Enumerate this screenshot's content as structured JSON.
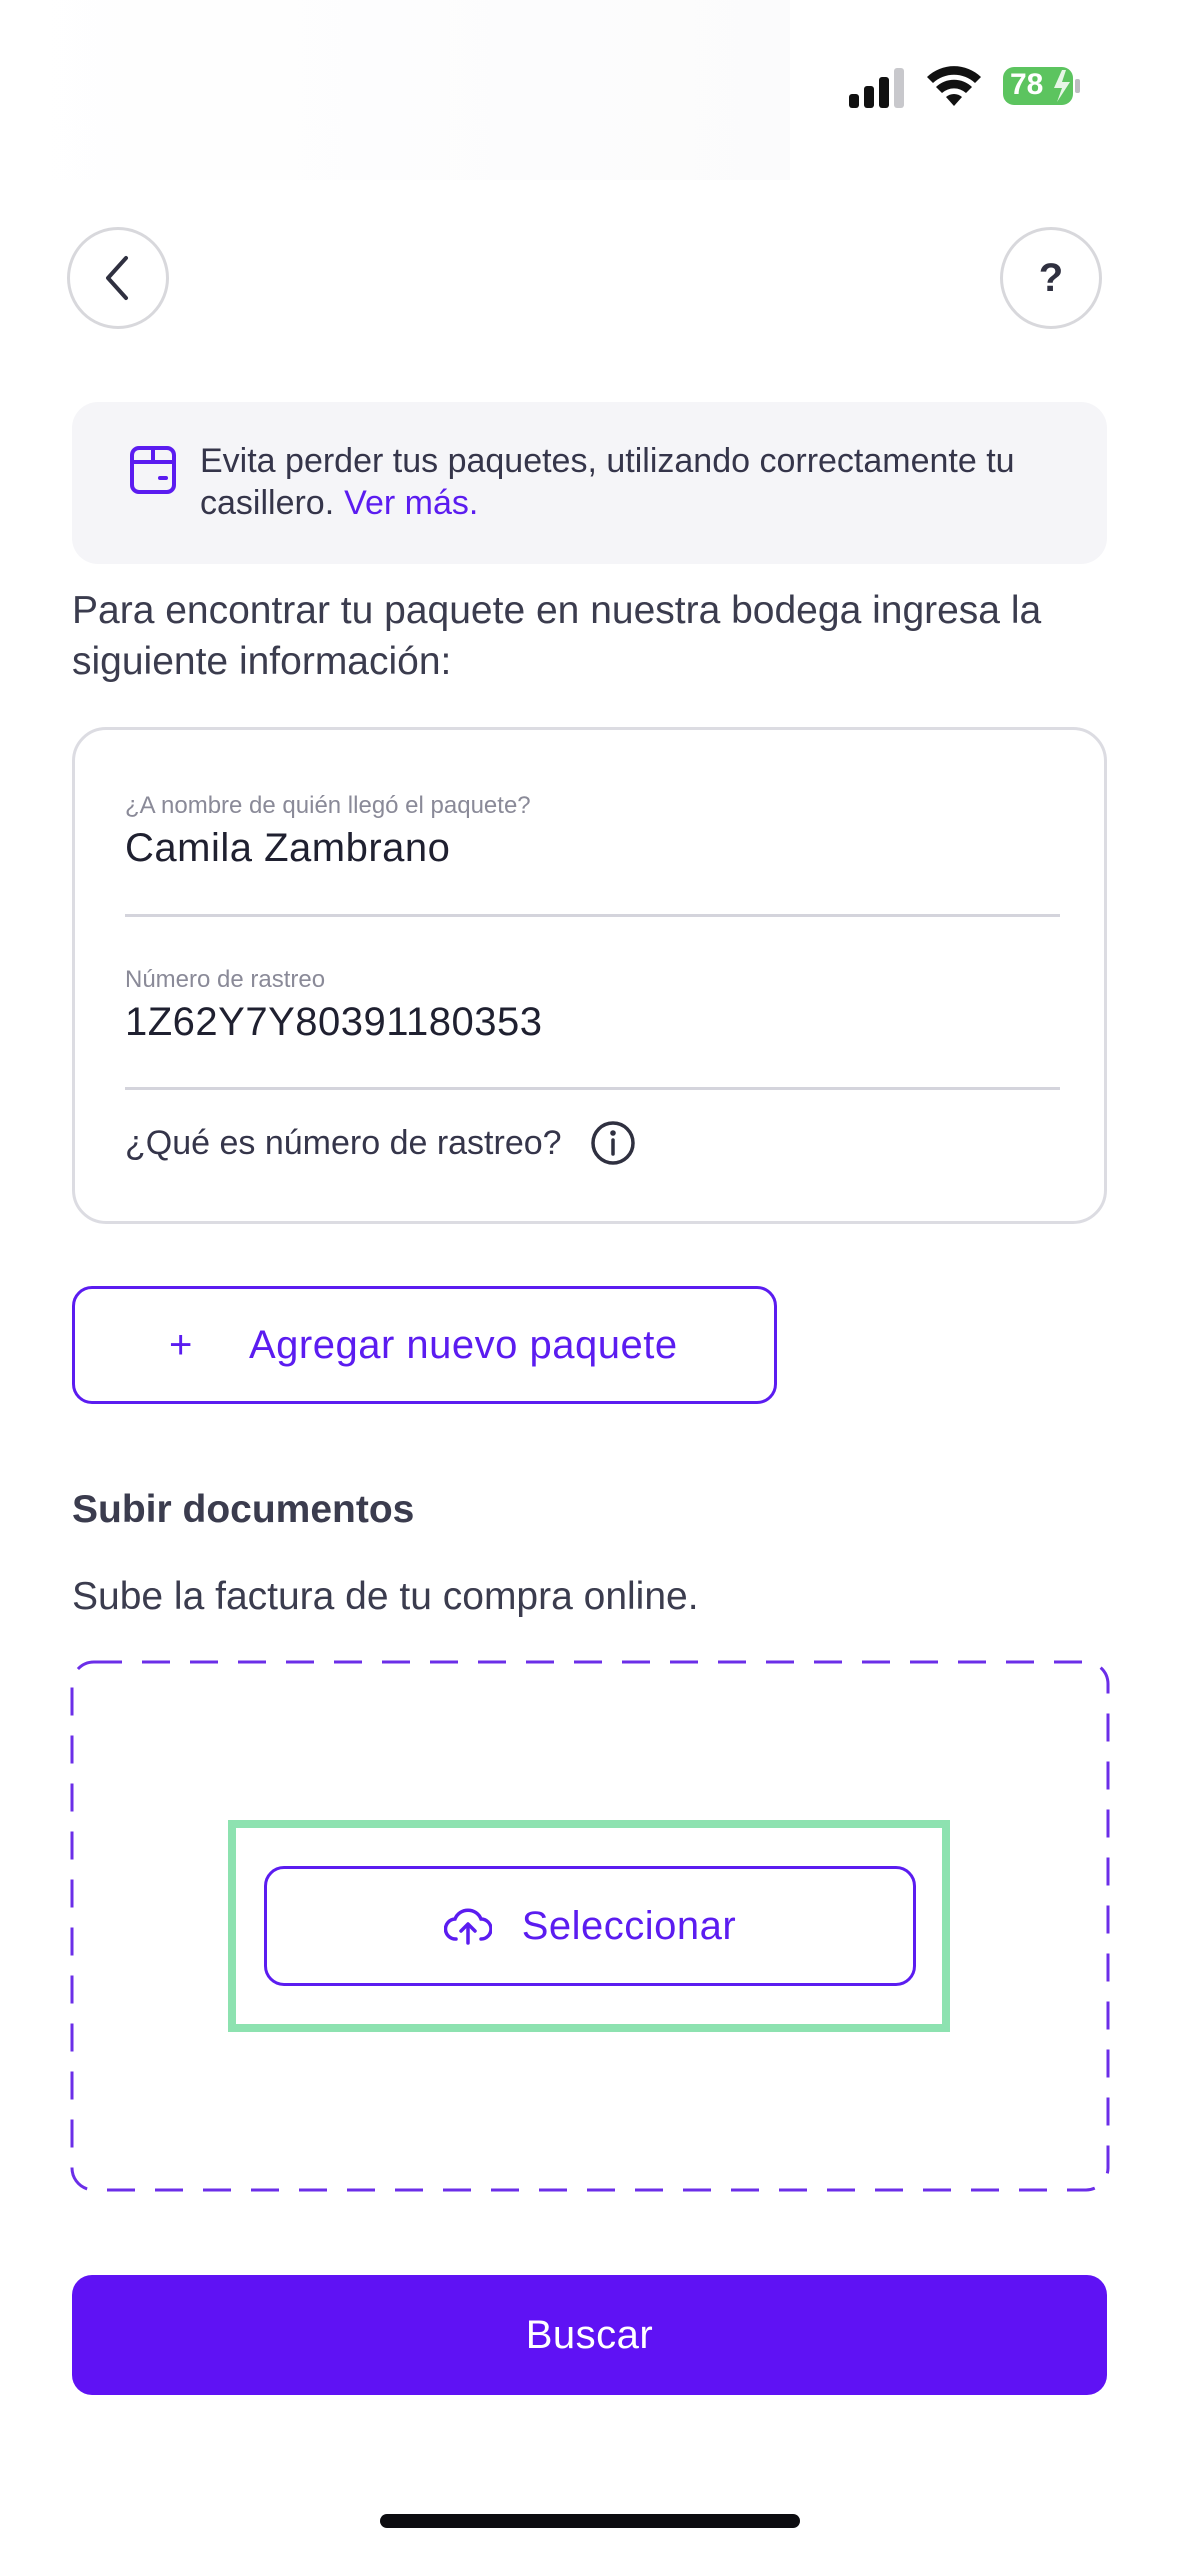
{
  "status_bar": {
    "battery_level": "78",
    "signal_icon": "cellular-signal-icon",
    "wifi_icon": "wifi-icon",
    "battery_color": "#5cc45f"
  },
  "header": {
    "back_icon": "chevron-left-icon",
    "help_label": "?"
  },
  "banner": {
    "text": "Evita perder tus paquetes, utilizando correctamente tu casillero.",
    "link": "Ver más.",
    "icon": "package-box-icon"
  },
  "intro": "Para encontrar tu paquete en nuestra bodega ingresa la siguiente información:",
  "form": {
    "recipient_label": "¿A nombre de quién llegó el paquete?",
    "recipient_value": "Camila Zambrano",
    "tracking_label": "Número de rastreo",
    "tracking_value": "1Z62Y7Y80391180353",
    "tracking_help": "¿Qué es número de rastreo?"
  },
  "add_package": {
    "plus": "+",
    "label": "Agregar nuevo paquete"
  },
  "upload": {
    "title": "Subir documentos",
    "subtitle": "Sube la factura de tu compra online.",
    "select_label": "Seleccionar",
    "icon": "cloud-upload-icon"
  },
  "primary_button": "Buscar",
  "colors": {
    "accent": "#5b1cf0",
    "primary_button": "#5f12f4",
    "highlight": "#8de2b0"
  }
}
